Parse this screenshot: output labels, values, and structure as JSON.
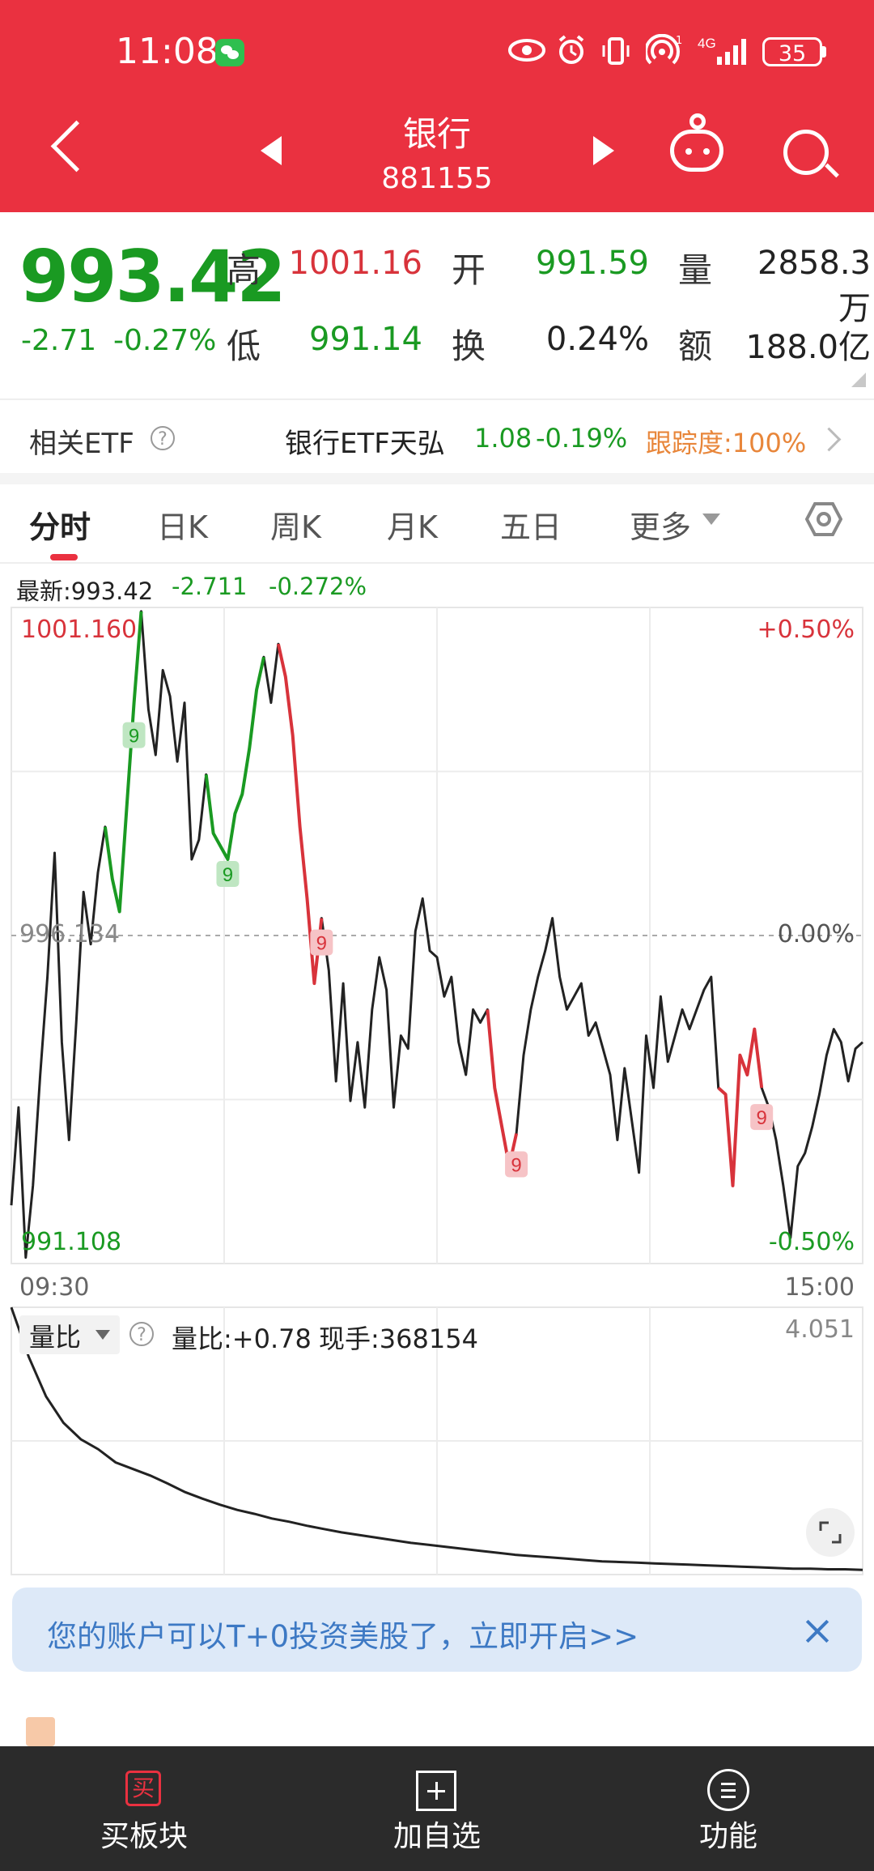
{
  "status_bar": {
    "time": "11:08",
    "network": "4G",
    "battery": "35"
  },
  "nav": {
    "title": "银行",
    "code": "881155"
  },
  "quote": {
    "price": "993.42",
    "change": "-2.71",
    "change_pct": "-0.27%",
    "high_label": "高",
    "high": "1001.16",
    "open_label": "开",
    "open": "991.59",
    "volume_label": "量",
    "volume": "2858.3万",
    "low_label": "低",
    "low": "991.14",
    "turnover_label": "换",
    "turnover": "0.24%",
    "amount_label": "额",
    "amount": "188.0亿"
  },
  "etf": {
    "label": "相关ETF",
    "help": "?",
    "name": "银行ETF天弘",
    "price": "1.08",
    "change": "-0.19%",
    "tracking": "跟踪度:100%"
  },
  "tabs": [
    "分时",
    "日K",
    "周K",
    "月K",
    "五日",
    "更多"
  ],
  "intraday": {
    "latest_label": "最新:993.42",
    "latest_change": "-2.711",
    "latest_pct": "-0.272%",
    "y_high": "1001.160",
    "y_mid": "996.134",
    "y_low": "991.108",
    "pct_high": "+0.50%",
    "pct_mid": "0.00%",
    "pct_low": "-0.50%",
    "time_start": "09:30",
    "time_end": "15:00",
    "signal_label": "9"
  },
  "volume_ratio": {
    "selector": "量比",
    "ratio_text": "量比:+0.78",
    "hand_text": "现手:368154",
    "max": "4.051"
  },
  "chart_data": {
    "type": "line",
    "title": "",
    "series": [
      {
        "name": "",
        "x_range": [
          "09:30",
          "15:00"
        ],
        "values": [
          992.0,
          993.5,
          991.2,
          992.3,
          994.0,
          995.5,
          997.4,
          994.5,
          993.0,
          994.8,
          996.8,
          996.0,
          997.1,
          997.8,
          997.0,
          996.5,
          998.1,
          999.7,
          1001.1,
          999.6,
          998.9,
          1000.2,
          999.8,
          998.8,
          999.7,
          997.3,
          997.6,
          998.6,
          997.7,
          997.5,
          997.3,
          998.0,
          998.3,
          999.0,
          999.9,
          1000.4,
          999.7,
          1000.6,
          1000.1,
          999.2,
          997.8,
          996.7,
          995.4,
          996.4,
          995.6,
          993.9,
          995.4,
          993.6,
          994.5,
          993.5,
          995.0,
          995.8,
          995.3,
          993.5,
          994.6,
          994.4,
          996.2,
          996.7,
          995.9,
          995.8,
          995.2,
          995.5,
          994.5,
          994.0,
          995.0,
          994.8,
          995.0,
          993.8,
          993.2,
          992.6,
          993.1,
          994.3,
          995.0,
          995.5,
          995.9,
          996.4,
          995.5,
          995.0,
          995.2,
          995.4,
          994.6,
          994.8,
          994.4,
          994.0,
          993.0,
          994.1,
          993.3,
          992.5,
          994.6,
          993.8,
          995.2,
          994.2,
          994.6,
          995.0,
          994.7,
          995.0,
          995.3,
          995.5,
          993.8,
          993.7,
          992.3,
          994.3,
          994.0,
          994.7,
          993.8,
          993.5,
          993.0,
          992.3,
          991.5,
          992.6,
          992.8,
          993.2,
          993.7,
          994.3,
          994.7,
          994.5,
          993.9,
          994.4,
          994.5
        ]
      }
    ],
    "xlim": [
      "09:30",
      "15:00"
    ],
    "ylim": [
      991.108,
      1001.16
    ],
    "reference": 996.134,
    "volume_ratio_series": {
      "name": "量比",
      "ylim": [
        0,
        4.051
      ],
      "values": [
        4.05,
        3.3,
        2.7,
        2.3,
        2.05,
        1.9,
        1.7,
        1.6,
        1.5,
        1.38,
        1.25,
        1.15,
        1.06,
        0.98,
        0.92,
        0.85,
        0.8,
        0.74,
        0.69,
        0.64,
        0.6,
        0.56,
        0.52,
        0.48,
        0.45,
        0.42,
        0.39,
        0.36,
        0.33,
        0.3,
        0.28,
        0.26,
        0.24,
        0.22,
        0.2,
        0.19,
        0.18,
        0.17,
        0.16,
        0.15,
        0.14,
        0.13,
        0.12,
        0.11,
        0.1,
        0.09,
        0.09,
        0.08,
        0.08,
        0.07
      ]
    }
  },
  "banner": {
    "text": "您的账户可以T+0投资美股了，立即开启>>"
  },
  "footer": {
    "buy_label": "买板块",
    "buy_icon": "买",
    "add_label": "加自选",
    "func_label": "功能"
  },
  "colors": {
    "header": "#ea3140",
    "up": "#d8333b",
    "down": "#1a9a22",
    "accent": "#e8863a"
  }
}
